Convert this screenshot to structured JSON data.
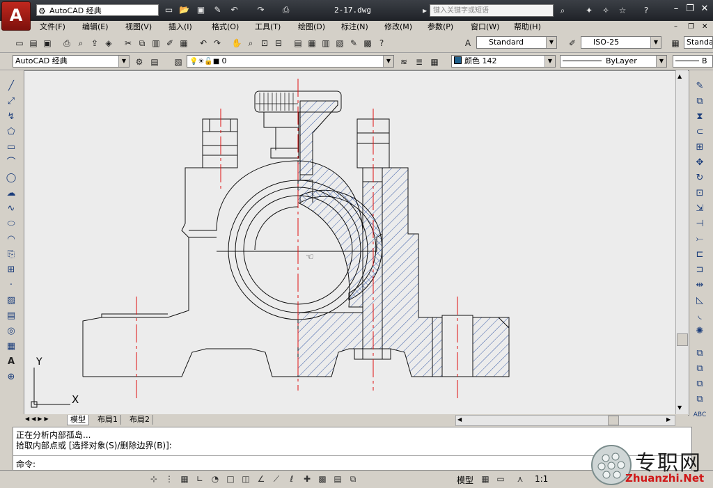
{
  "app": {
    "logo_letter": "A",
    "workspace": "AutoCAD 经典",
    "document_title": "2-17.dwg",
    "search_placeholder": "键入关键字或短语"
  },
  "menu": [
    "文件(F)",
    "编辑(E)",
    "视图(V)",
    "插入(I)",
    "格式(O)",
    "工具(T)",
    "绘图(D)",
    "标注(N)",
    "修改(M)",
    "参数(P)",
    "窗口(W)",
    "帮助(H)"
  ],
  "styles": {
    "text_style": "Standard",
    "dim_style": "ISO-25",
    "table_style": "Standa"
  },
  "layers": {
    "workspace": "AutoCAD 经典",
    "current_layer": "0",
    "color": "颜色 142",
    "linetype": "ByLayer",
    "lineweight_prefix": "B"
  },
  "tabs": [
    "模型",
    "布局1",
    "布局2"
  ],
  "command": {
    "lines": [
      "正在分析内部孤岛...",
      "拾取内部点或 [选择对象(S)/删除边界(B)]:",
      "命令:"
    ]
  },
  "status": {
    "model_label": "模型",
    "scale": "1:1"
  },
  "watermark": {
    "cn": "专职网",
    "url": "Zhuanzhi.Net"
  },
  "ucs": {
    "x_label": "X",
    "y_label": "Y"
  },
  "colors": {
    "accent_red": "#c0281e",
    "layer_color": "#1f5f8a",
    "hatch": "#2a4fa0",
    "centerline": "#e01010"
  }
}
